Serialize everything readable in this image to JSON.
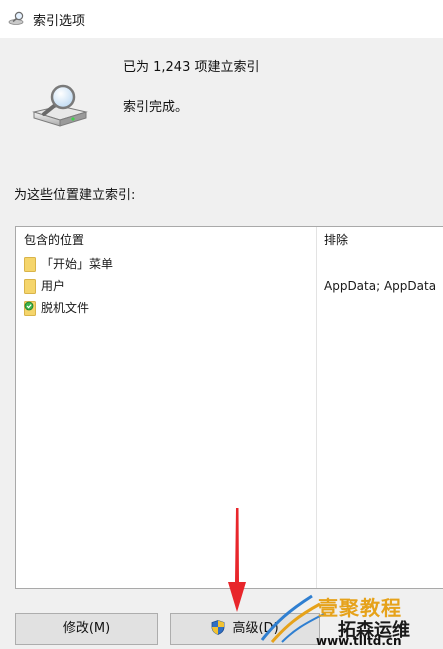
{
  "window": {
    "title": "索引选项"
  },
  "status": {
    "indexed_count": "已为 1,243 项建立索引",
    "index_state": "索引完成。"
  },
  "locations": {
    "section_label": "为这些位置建立索引:",
    "columns": {
      "included": "包含的位置",
      "excluded": "排除"
    },
    "rows": [
      {
        "label": "「开始」菜单",
        "exclusion": "",
        "icon": "folder-icon"
      },
      {
        "label": "用户",
        "exclusion": "AppData; AppData",
        "icon": "folder-icon"
      },
      {
        "label": "脱机文件",
        "exclusion": "",
        "icon": "offline-files-icon"
      }
    ]
  },
  "buttons": {
    "modify": "修改(M)",
    "advanced": "高级(D)"
  },
  "watermark": {
    "top": "壹聚教程",
    "middle": "拓森运维",
    "url": "www.tlltd.cn"
  },
  "colors": {
    "arrow": "#e8262b",
    "folder": "#f5d56b",
    "shield_blue": "#2f6fc4",
    "shield_yellow": "#f1c232"
  }
}
